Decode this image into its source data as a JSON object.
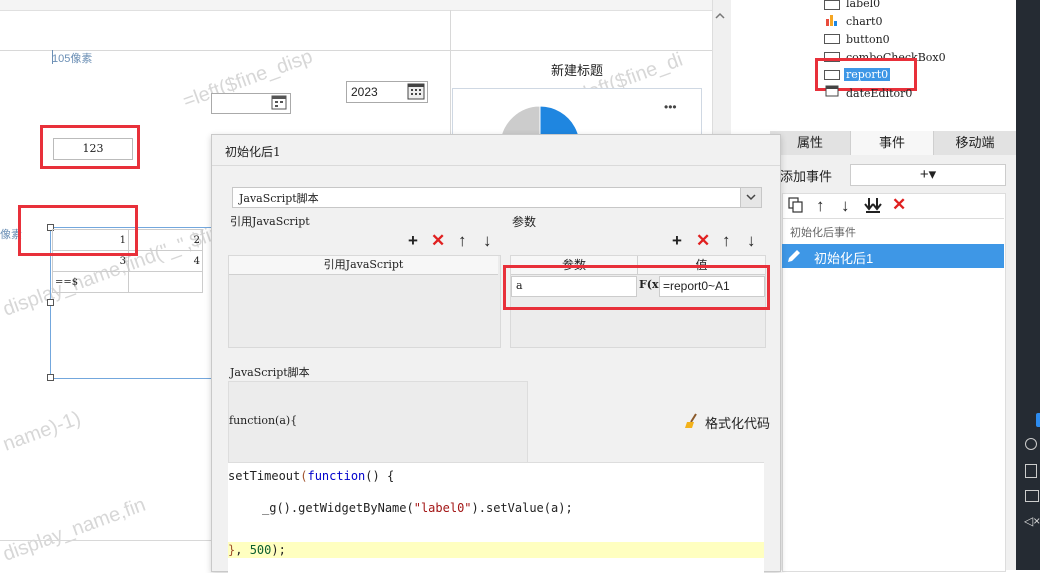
{
  "designer": {
    "ruler_label": "105像素",
    "pixel_label": "像素",
    "date_value": "2023",
    "label_value": "123",
    "chart_title": "新建标题",
    "chart_menu": "•••",
    "table_cells": [
      [
        "1",
        "2"
      ],
      [
        "3",
        "4"
      ],
      [
        "==$",
        ""
      ]
    ],
    "watermarks": [
      "=left($fine_disp",
      "=left($fine_di",
      "display_name,find(\"_\",$fine",
      "name)-1)",
      "display_name,fin"
    ]
  },
  "widget_tree": {
    "items": [
      {
        "label": "label0",
        "icon": "label-widget-icon"
      },
      {
        "label": "chart0",
        "icon": "chart-widget-icon"
      },
      {
        "label": "button0",
        "icon": "button-widget-icon"
      },
      {
        "label": "comboCheckBox0",
        "icon": "combo-widget-icon"
      },
      {
        "label": "report0",
        "icon": "report-widget-icon",
        "selected": true
      },
      {
        "label": "dateEditor0",
        "icon": "date-widget-icon"
      }
    ]
  },
  "panel_tabs": [
    "属性",
    "事件",
    "移动端"
  ],
  "events": {
    "add_label": "添加事件",
    "add_button": "+▾",
    "group_label": "初始化后事件",
    "selected_event": "初始化后1"
  },
  "dialog": {
    "title": "初始化后1",
    "type_select": "JavaScript脚本",
    "ref_js_label": "引用JavaScript",
    "ref_js_header": "引用JavaScript",
    "params_label": "参数",
    "param_header": "参数",
    "value_header": "值",
    "param_name": "a",
    "fx_label": "F(x)",
    "param_value": "=report0~A1",
    "script_label": "JavaScript脚本",
    "function_sig": "function(a){",
    "format_button": "格式化代码",
    "code_lines": {
      "l1_a": "setTimeout",
      "l1_b": "(",
      "l1_c": "function",
      "l1_d": "() {",
      "l2_a": "_g",
      "l2_b": "().getWidgetByName(",
      "l2_c": "\"label0\"",
      "l2_d": ").setValue(a);",
      "l3_a": "}",
      "l3_b": ", ",
      "l3_c": "500",
      "l3_d": ");"
    }
  },
  "colors": {
    "accent": "#3e97e6",
    "highlight": "#e8303a",
    "pie": [
      "#1f86e0",
      "#f5a623",
      "#e94b3c",
      "#2bbbad",
      "#7ac943"
    ]
  }
}
